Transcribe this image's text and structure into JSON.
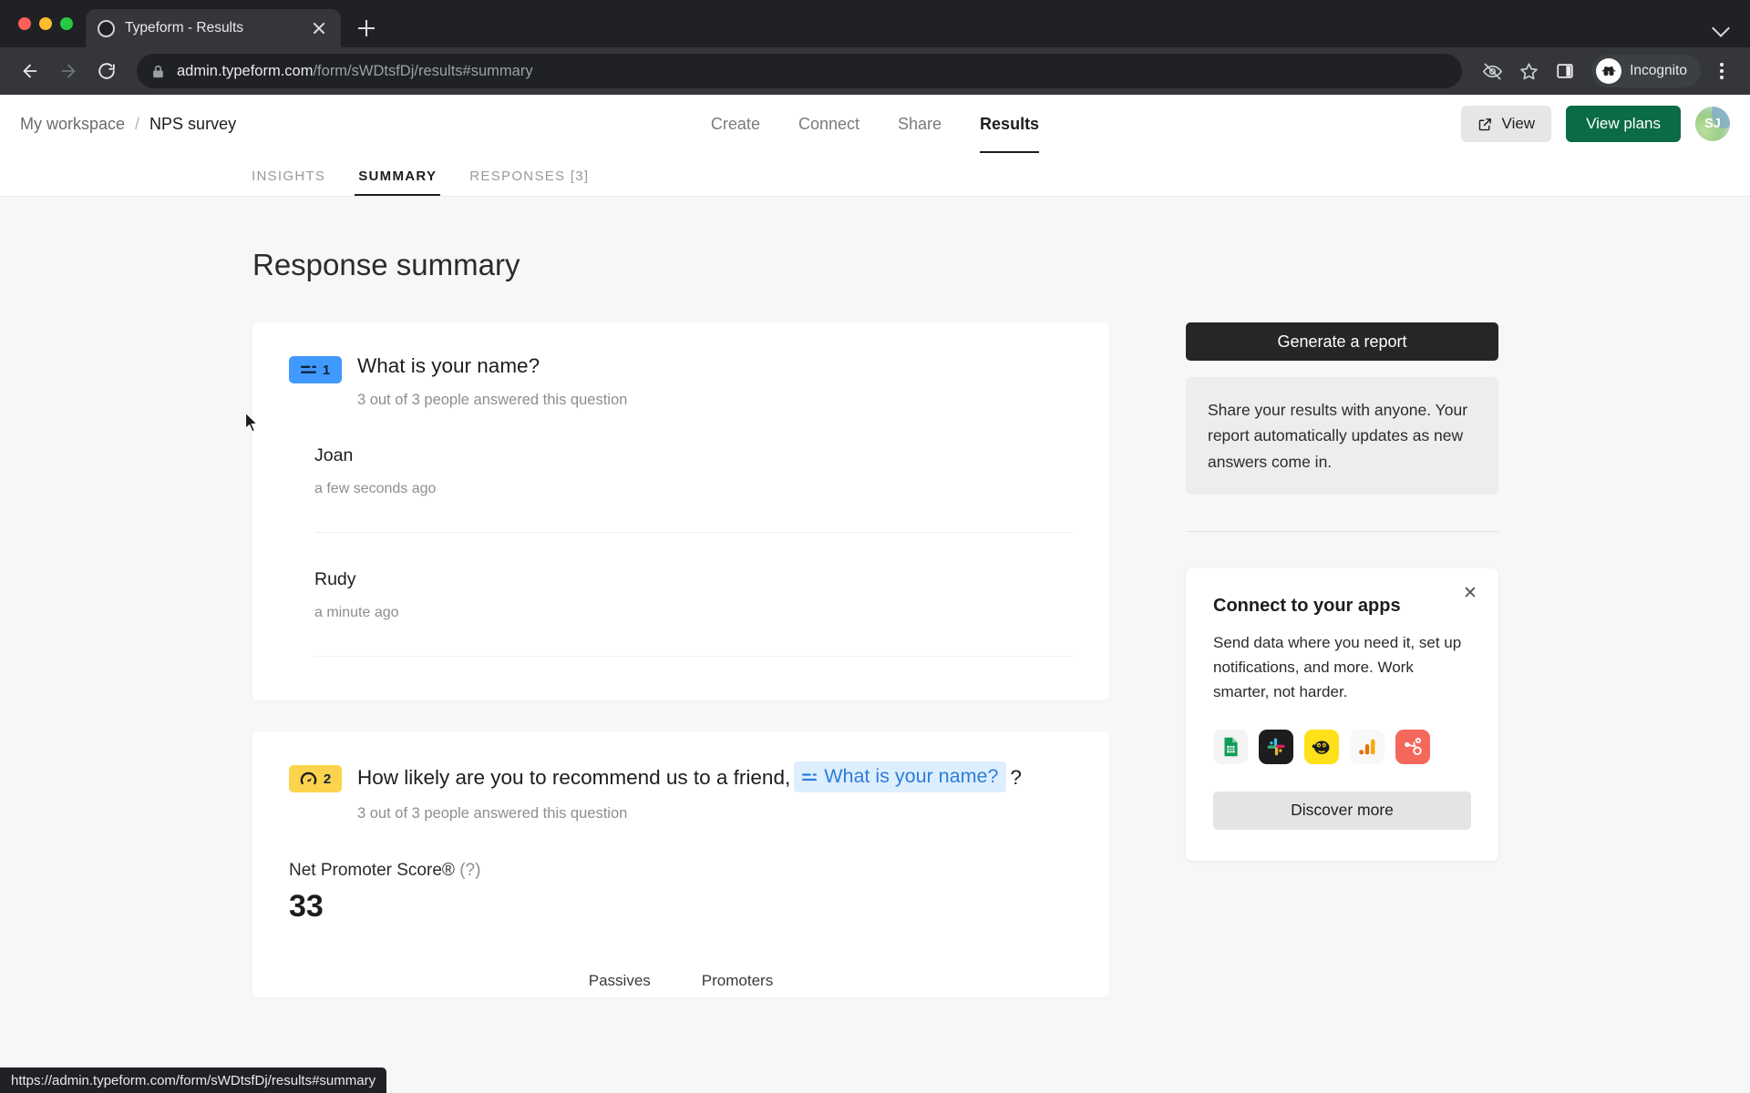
{
  "browser": {
    "tab": {
      "title": "Typeform - Results",
      "favicon": "loading-circle-icon"
    },
    "new_tab_label": "+",
    "omnibox": {
      "lock_icon": "lock-icon",
      "url_host": "admin.typeform.com",
      "url_path": "/form/sWDtsfDj/results#summary"
    },
    "toolbar_icons": [
      "back-icon",
      "forward-icon",
      "reload-icon",
      "eye-off-icon",
      "star-icon",
      "side-panel-icon"
    ],
    "incognito_label": "Incognito",
    "menu_icon": "kebab-menu-icon",
    "status_url": "https://admin.typeform.com/form/sWDtsfDj/results#summary"
  },
  "app": {
    "breadcrumb": {
      "workspace": "My workspace",
      "separator": "/",
      "form": "NPS survey"
    },
    "nav": [
      {
        "label": "Create",
        "active": false
      },
      {
        "label": "Connect",
        "active": false
      },
      {
        "label": "Share",
        "active": false
      },
      {
        "label": "Results",
        "active": true
      }
    ],
    "header_actions": {
      "view_label": "View",
      "view_icon": "external-link-icon",
      "plans_label": "View plans",
      "plans_color": "#0b6b47",
      "avatar_initials": "SJ"
    },
    "subtabs": [
      {
        "label": "INSIGHTS",
        "active": false
      },
      {
        "label": "SUMMARY",
        "active": true
      },
      {
        "label": "RESPONSES [3]",
        "active": false
      }
    ],
    "page_title": "Response summary"
  },
  "questions": [
    {
      "number": "1",
      "badge_color": "#4099ff",
      "badge_icon": "short-text-icon",
      "title": "What is your name?",
      "answered": "3 out of 3 people answered this question",
      "answers": [
        {
          "value": "Joan",
          "time": "a few seconds ago"
        },
        {
          "value": "Rudy",
          "time": "a minute ago"
        }
      ]
    },
    {
      "number": "2",
      "badge_color": "#fbd34d",
      "badge_icon": "nps-gauge-icon",
      "title_before": "How likely are you to recommend us to a friend,",
      "recall_chip": {
        "icon": "short-text-icon",
        "label": "What is your name?"
      },
      "title_after": "?",
      "answered": "3 out of 3 people answered this question",
      "nps": {
        "label": "Net Promoter Score®",
        "help": "(?)",
        "value": "33",
        "legend": [
          "Passives",
          "Promoters"
        ]
      }
    }
  ],
  "sidebar": {
    "generate_report_label": "Generate a report",
    "share_note": "Share your results with anyone. Your report automatically updates as new answers come in.",
    "apps_card": {
      "close_icon": "close-icon",
      "title": "Connect to your apps",
      "description": "Send data where you need it, set up notifications, and more. Work smarter, not harder.",
      "apps": [
        "google-sheets-icon",
        "slack-icon",
        "mailchimp-icon",
        "google-analytics-icon",
        "hubspot-icon"
      ],
      "discover_label": "Discover more"
    }
  }
}
